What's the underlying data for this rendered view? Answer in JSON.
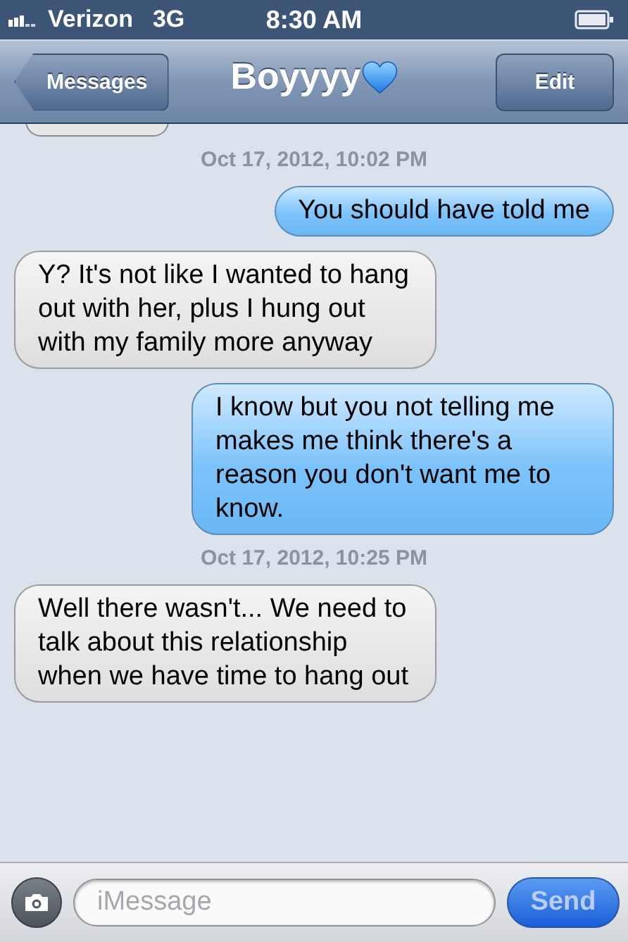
{
  "status_bar": {
    "carrier": "Verizon",
    "network": "3G",
    "time": "8:30 AM"
  },
  "nav_bar": {
    "back_button": "Messages",
    "title": "Boyyyy",
    "edit_button": "Edit"
  },
  "thread": [
    {
      "kind": "partial"
    },
    {
      "kind": "timestamp",
      "text": "Oct 17, 2012, 10:02 PM"
    },
    {
      "kind": "sent",
      "text": "You should have told me"
    },
    {
      "kind": "received",
      "text": "Y? It's not like I wanted to hang out with her, plus I hung out with my family more anyway"
    },
    {
      "kind": "sent",
      "text": "I know but you not telling me makes me think there's a reason you don't want me to know."
    },
    {
      "kind": "timestamp",
      "text": "Oct 17, 2012, 10:25 PM"
    },
    {
      "kind": "received",
      "text": "Well there wasn't... We need to talk about this relationship when we have time to hang out"
    }
  ],
  "composer": {
    "placeholder": "iMessage",
    "send_button": "Send"
  }
}
